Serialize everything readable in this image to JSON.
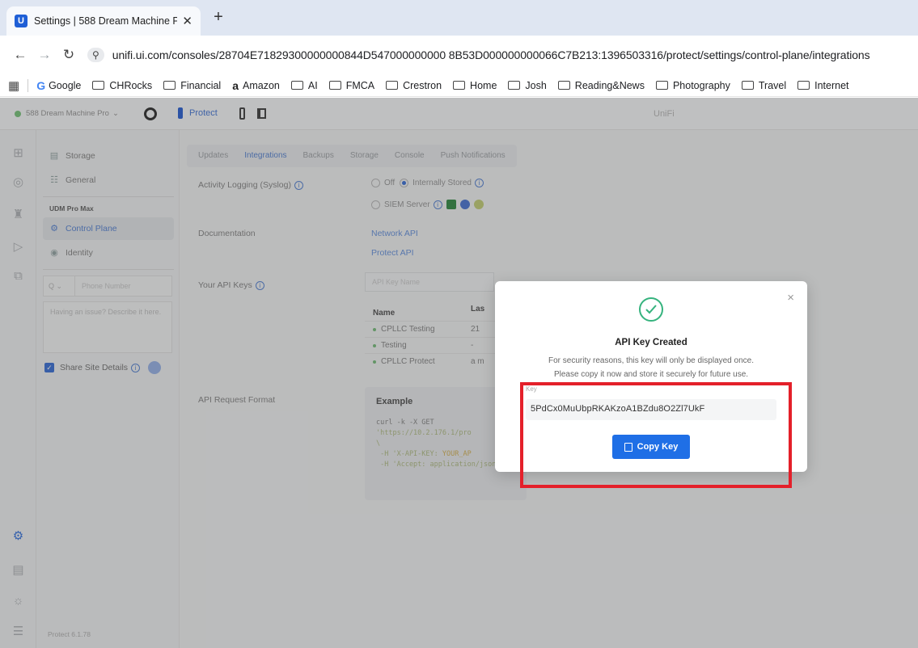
{
  "browser": {
    "tab_title": "Settings | 588 Dream Machine P",
    "tab_favicon": "U",
    "new_tab": "+",
    "url": "unifi.ui.com/consoles/28704E71829300000000844D547000000000 8B53D000000000066C7B213:1396503316/protect/settings/control-plane/integrations",
    "bookmarks": [
      "CHRocks",
      "Financial",
      "Amazon",
      "AI",
      "FMCA",
      "Crestron",
      "Home",
      "Josh",
      "Reading&News",
      "Photography",
      "Travel",
      "Internet"
    ],
    "bookmark_google": "Google"
  },
  "topbar": {
    "console": "588 Dream Machine Pro",
    "app": "Protect",
    "brand": "UniFi"
  },
  "sidenav": {
    "storage": "Storage",
    "general": "General",
    "section": "UDM Pro Max",
    "control_plane": "Control Plane",
    "identity": "Identity",
    "country_code": "Q",
    "phone_placeholder": "Phone Number",
    "issue_placeholder": "Having an issue? Describe it here.",
    "share_label": "Share Site Details",
    "version": "Protect 6.1.78"
  },
  "tabs": [
    "Updates",
    "Integrations",
    "Backups",
    "Storage",
    "Console",
    "Push Notifications"
  ],
  "settings": {
    "activity_label": "Activity Logging (Syslog)",
    "opt_off": "Off",
    "opt_internal": "Internally Stored",
    "opt_siem": "SIEM Server",
    "doc_label": "Documentation",
    "network_api": "Network API",
    "protect_api": "Protect API",
    "keys_label": "Your API Keys",
    "key_name_placeholder": "API Key Name",
    "table_head_name": "Name",
    "table_head_last": "Las",
    "keys": [
      {
        "name": "CPLLC Testing",
        "last": "21"
      },
      {
        "name": "Testing",
        "last": "-"
      },
      {
        "name": "CPLLC Protect",
        "last": "a m"
      }
    ],
    "request_label": "API Request Format",
    "example_title": "Example",
    "code_l1": "curl -k -X GET",
    "code_l2": "'https://10.2.176.1/pro",
    "code_l3": "\\",
    "code_l4a": " -H 'X-API-KEY: ",
    "code_l4b": "YOUR_AP",
    "code_l5": " -H 'Accept: application/json'"
  },
  "modal": {
    "title": "API Key Created",
    "desc_line1": "For security reasons, this key will only be displayed once.",
    "desc_line2": "Please copy it now and store it securely for future use.",
    "key_label": "Key",
    "key_value": "5PdCx0MuUbpRKAKzoA1BZdu8O2Zl7UkF",
    "copy_button": "Copy Key",
    "close": "×"
  },
  "colors": {
    "accent": "#1f6fe6",
    "highlight": "#e4202a",
    "success": "#36b37e"
  }
}
